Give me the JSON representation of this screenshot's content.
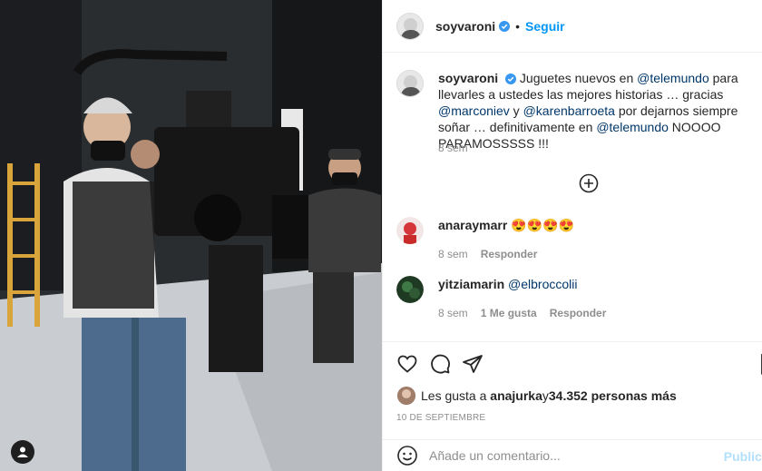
{
  "post": {
    "username": "soyvaroni",
    "follow_label": "Seguir",
    "caption_parts": {
      "p1": "Juguetes nuevos en ",
      "m1": "@telemundo",
      "p2": " para llevarles a ustedes las mejores historias … gracias ",
      "m2": "@marconiev",
      "p3": " y ",
      "m3": "@karenbarroeta",
      "p4": " por dejarnos siempre soñar … definitivamente en ",
      "m4": "@telemundo",
      "p5": " NOOOO PARAMOSSSSS !!!"
    },
    "caption_time": "8 sem"
  },
  "comments": [
    {
      "username": "anaraymarr",
      "text": "😍😍😍😍",
      "time": "8 sem",
      "reply_label": "Responder"
    },
    {
      "username": "yitziamarin",
      "text": "@elbroccolii",
      "time": "8 sem",
      "likes_label": "1 Me gusta",
      "reply_label": "Responder"
    }
  ],
  "likes": {
    "prefix": "Les gusta a ",
    "user": "anajurka",
    "mid": " y ",
    "count": "34.352 personas más"
  },
  "date": "10 DE SEPTIEMBRE",
  "add_comment": {
    "placeholder": "Añade un comentario...",
    "publish_label": "Publicar"
  },
  "icons": {
    "verified": "verified-badge-icon",
    "more": "plus-circle-icon",
    "like": "heart-icon",
    "comment": "comment-icon",
    "share": "paper-plane-icon",
    "emoji": "emoji-icon",
    "user_tag": "user-icon"
  },
  "colors": {
    "accent": "#0095f6",
    "link": "#00376b",
    "muted": "#8e8e8e"
  }
}
